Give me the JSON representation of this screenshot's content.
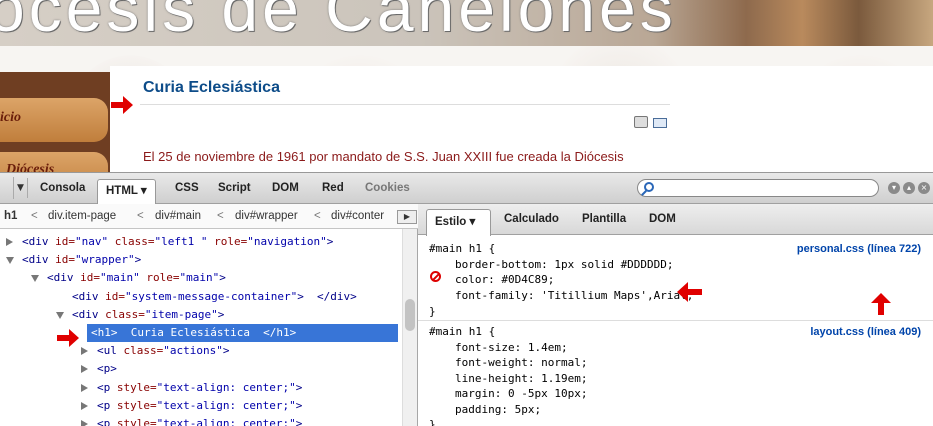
{
  "site": {
    "banner_title": "ócesis de Canelones",
    "menu_items": [
      "icio",
      "Diócesis"
    ],
    "article_title": "Curia Eclesiástica",
    "body_text": "El 25 de noviembre de 1961 por mandato de S.S. Juan XXIII fue creada la Diócesis"
  },
  "firebug": {
    "tabs": [
      "Consola",
      "HTML ▾",
      "CSS",
      "Script",
      "DOM",
      "Red",
      "Cookies"
    ],
    "active_tab": "HTML",
    "search_placeholder": "",
    "breadcrumb": [
      "h1",
      "div.item-page",
      "div#main",
      "div#wrapper",
      "div#conter"
    ],
    "tree": [
      {
        "indent": 0,
        "twisty": "closed",
        "parts": [
          [
            "tag",
            "<div "
          ],
          [
            "attr",
            "id="
          ],
          [
            "val",
            "\"nav\""
          ],
          [
            "attr",
            " class="
          ],
          [
            "val",
            "\"left1 \""
          ],
          [
            "attr",
            " role="
          ],
          [
            "val",
            "\"navigation\""
          ],
          [
            "tag",
            ">"
          ]
        ]
      },
      {
        "indent": 0,
        "twisty": "open",
        "parts": [
          [
            "tag",
            "<div "
          ],
          [
            "attr",
            "id="
          ],
          [
            "val",
            "\"wrapper\""
          ],
          [
            "tag",
            ">"
          ]
        ]
      },
      {
        "indent": 1,
        "twisty": "open",
        "parts": [
          [
            "tag",
            "<div "
          ],
          [
            "attr",
            "id="
          ],
          [
            "val",
            "\"main\""
          ],
          [
            "attr",
            " role="
          ],
          [
            "val",
            "\"main\""
          ],
          [
            "tag",
            ">"
          ]
        ]
      },
      {
        "indent": 2,
        "twisty": "none",
        "parts": [
          [
            "tag",
            "<div "
          ],
          [
            "attr",
            "id="
          ],
          [
            "val",
            "\"system-message-container\""
          ],
          [
            "tag",
            ">  </div>"
          ]
        ]
      },
      {
        "indent": 2,
        "twisty": "open",
        "parts": [
          [
            "tag",
            "<div "
          ],
          [
            "attr",
            "class="
          ],
          [
            "val",
            "\"item-page\""
          ],
          [
            "tag",
            ">"
          ]
        ]
      },
      {
        "indent": 3,
        "twisty": "none",
        "selected": true,
        "parts": [
          [
            "tag",
            "<h1>  Curia Eclesiástica  </h1>"
          ]
        ]
      },
      {
        "indent": 3,
        "twisty": "closed",
        "parts": [
          [
            "tag",
            "<ul "
          ],
          [
            "attr",
            "class="
          ],
          [
            "val",
            "\"actions\""
          ],
          [
            "tag",
            ">"
          ]
        ]
      },
      {
        "indent": 3,
        "twisty": "closed",
        "parts": [
          [
            "tag",
            "<p>"
          ]
        ]
      },
      {
        "indent": 3,
        "twisty": "closed",
        "parts": [
          [
            "tag",
            "<p "
          ],
          [
            "attr",
            "style="
          ],
          [
            "val",
            "\"text-align: center;\""
          ],
          [
            "tag",
            ">"
          ]
        ]
      },
      {
        "indent": 3,
        "twisty": "closed",
        "parts": [
          [
            "tag",
            "<p "
          ],
          [
            "attr",
            "style="
          ],
          [
            "val",
            "\"text-align: center;\""
          ],
          [
            "tag",
            ">"
          ]
        ]
      },
      {
        "indent": 3,
        "twisty": "closed",
        "parts": [
          [
            "tag",
            "<p "
          ],
          [
            "attr",
            "style="
          ],
          [
            "val",
            "\"text-align: center;\""
          ],
          [
            "tag",
            ">"
          ]
        ]
      }
    ],
    "side_tabs": [
      "Estilo ▾",
      "Calculado",
      "Plantilla",
      "DOM"
    ],
    "css_rules": [
      {
        "selector": "#main h1 {",
        "source": "personal.css (línea 722)",
        "props": [
          {
            "text": "border-bottom: 1px solid #DDDDDD;",
            "disabled": true
          },
          {
            "text": "color: #0D4C89;",
            "disabled": false
          },
          {
            "text": "font-family: 'Titillium Maps',Arial;",
            "disabled": false
          }
        ]
      },
      {
        "selector": "#main h1 {",
        "source": "layout.css (línea 409)",
        "props": [
          {
            "text": "font-size: 1.4em;",
            "disabled": false
          },
          {
            "text": "font-weight: normal;",
            "disabled": false
          },
          {
            "text": "line-height: 1.19em;",
            "disabled": false
          },
          {
            "text": "margin: 0 -5px 10px;",
            "disabled": false
          },
          {
            "text": "padding: 5px;",
            "disabled": false
          }
        ]
      }
    ],
    "closing_brace": "}"
  },
  "colors": {
    "accent_blue": "#0D4C89",
    "selection": "#3875d7",
    "arrow": "#e00000"
  }
}
